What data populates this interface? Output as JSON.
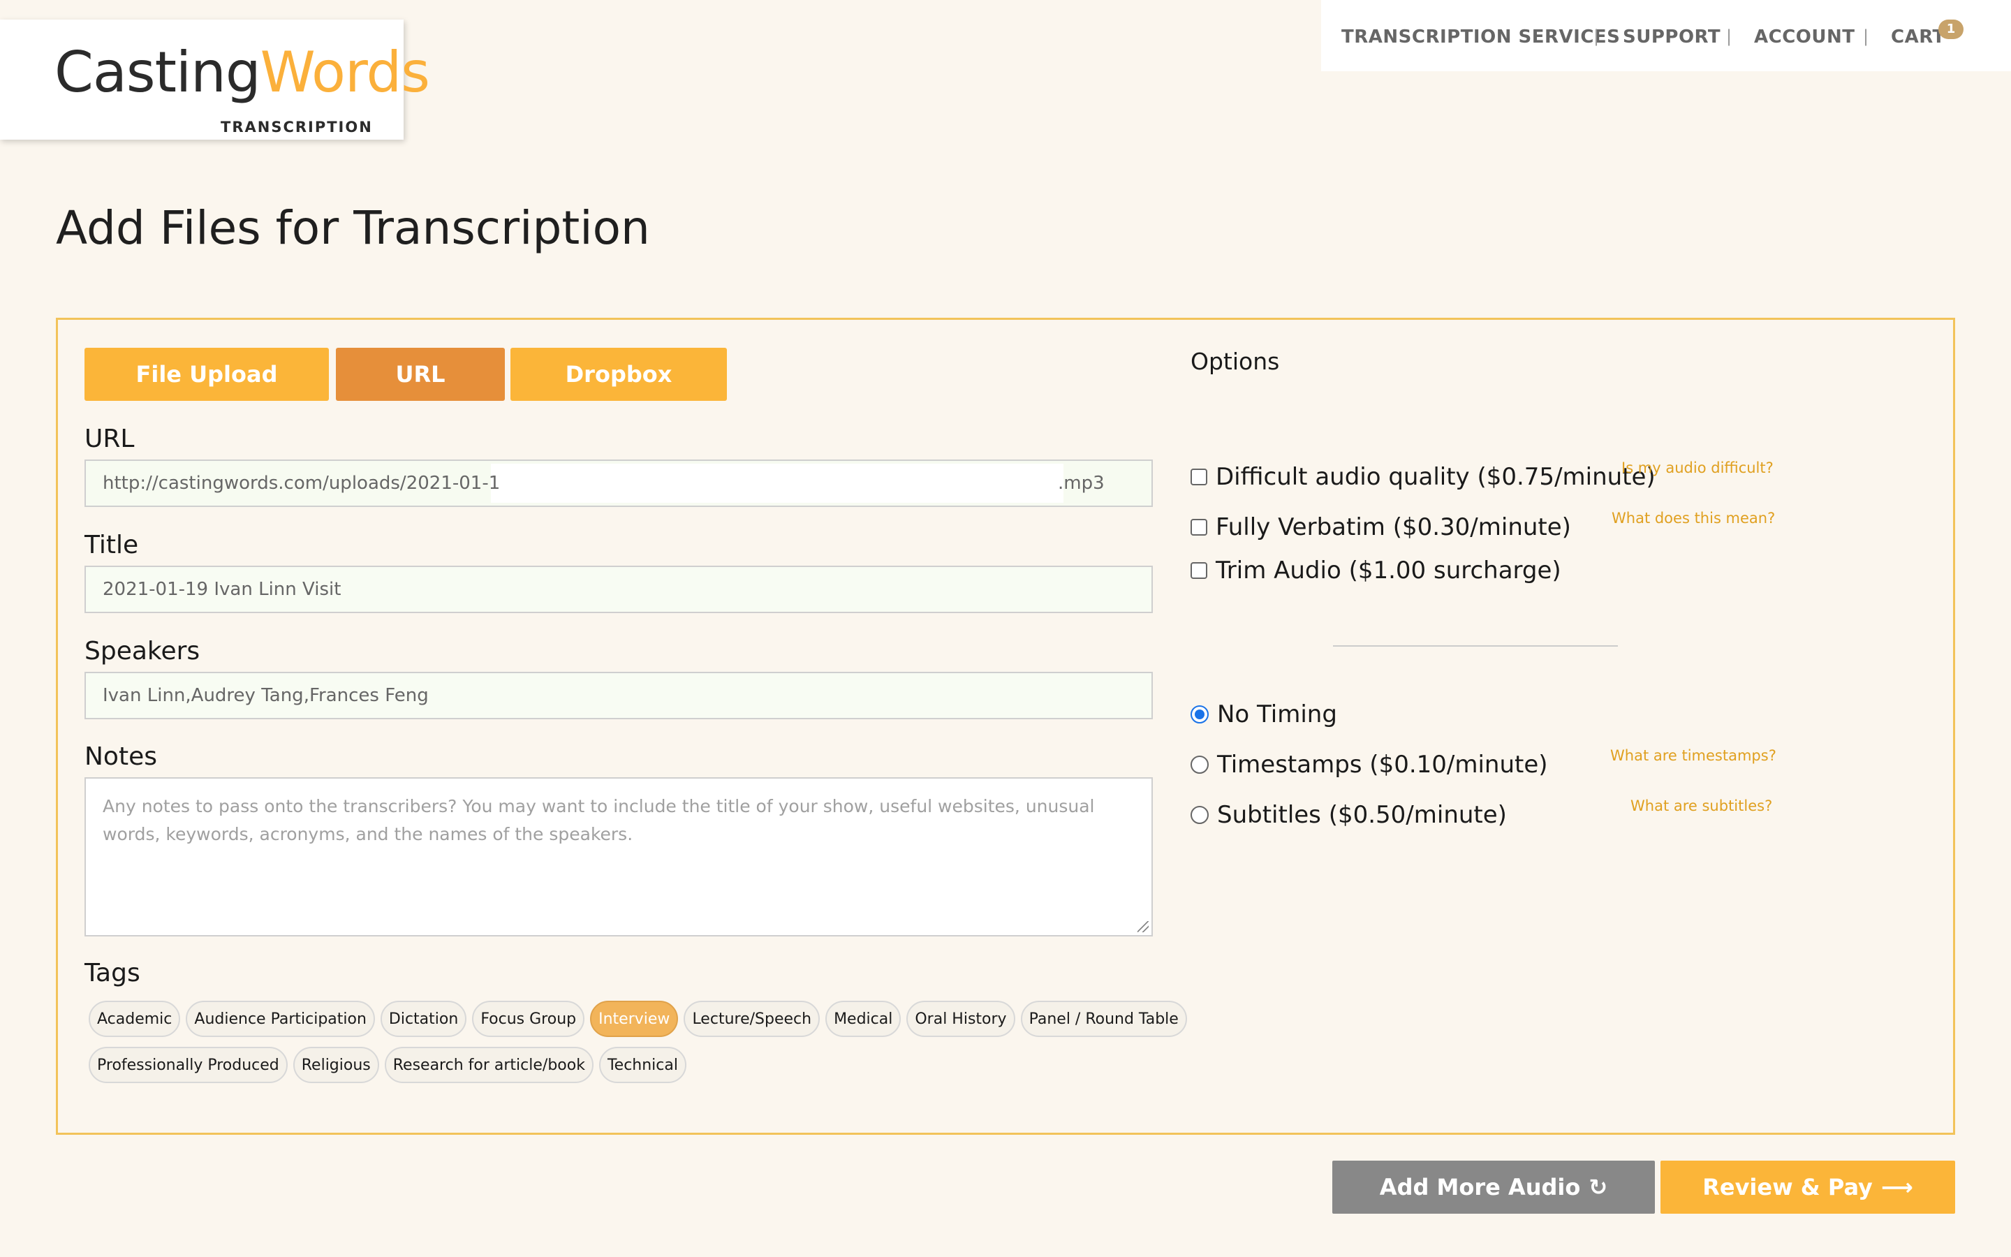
{
  "logo": {
    "part1": "Casting",
    "part2": "Words",
    "sub": "TRANSCRIPTION"
  },
  "nav": {
    "services": "TRANSCRIPTION SERVICES",
    "support": "SUPPORT",
    "account": "ACCOUNT",
    "cart": "CART",
    "cart_count": "1",
    "separator": "|"
  },
  "page": {
    "title": "Add Files for Transcription"
  },
  "tabs": {
    "upload": "File Upload",
    "url": "URL",
    "dropbox": "Dropbox"
  },
  "form": {
    "url_label": "URL",
    "url_prefix": "http://castingwords.com/uploads/2021-01-1",
    "url_suffix": ".mp3",
    "title_label": "Title",
    "title_value": "2021-01-19 Ivan Linn Visit",
    "speakers_label": "Speakers",
    "speakers_value": "Ivan Linn,Audrey Tang,Frances Feng",
    "notes_label": "Notes",
    "notes_placeholder": "Any notes to pass onto the transcribers? You may want to include the title of your show, useful websites, unusual words, keywords, acronyms, and the names of the speakers.",
    "tags_label": "Tags"
  },
  "tags": {
    "row1": [
      "Academic",
      "Audience Participation",
      "Dictation",
      "Focus Group",
      "Interview",
      "Lecture/Speech",
      "Medical",
      "Oral History",
      "Panel / Round Table"
    ],
    "row2": [
      "Professionally Produced",
      "Religious",
      "Research for article/book",
      "Technical"
    ],
    "active": "Interview"
  },
  "options": {
    "title": "Options",
    "difficult": "Difficult audio quality ($0.75/minute)",
    "difficult_help": "Is my audio difficult?",
    "verbatim": "Fully Verbatim ($0.30/minute)",
    "verbatim_help": "What does this mean?",
    "trim": "Trim Audio ($1.00 surcharge)",
    "no_timing": "No Timing",
    "timestamps": "Timestamps ($0.10/minute)",
    "timestamps_help": "What are timestamps?",
    "subtitles": "Subtitles ($0.50/minute)",
    "subtitles_help": "What are subtitles?"
  },
  "buttons": {
    "add_more": "Add More Audio",
    "add_more_icon": "↻",
    "review_pay": "Review & Pay",
    "review_pay_icon": "⟶"
  },
  "colors": {
    "accent": "#fbb539",
    "accent_dark": "#e68f3a",
    "border": "#f2c35a",
    "background": "#fbf6ee"
  }
}
